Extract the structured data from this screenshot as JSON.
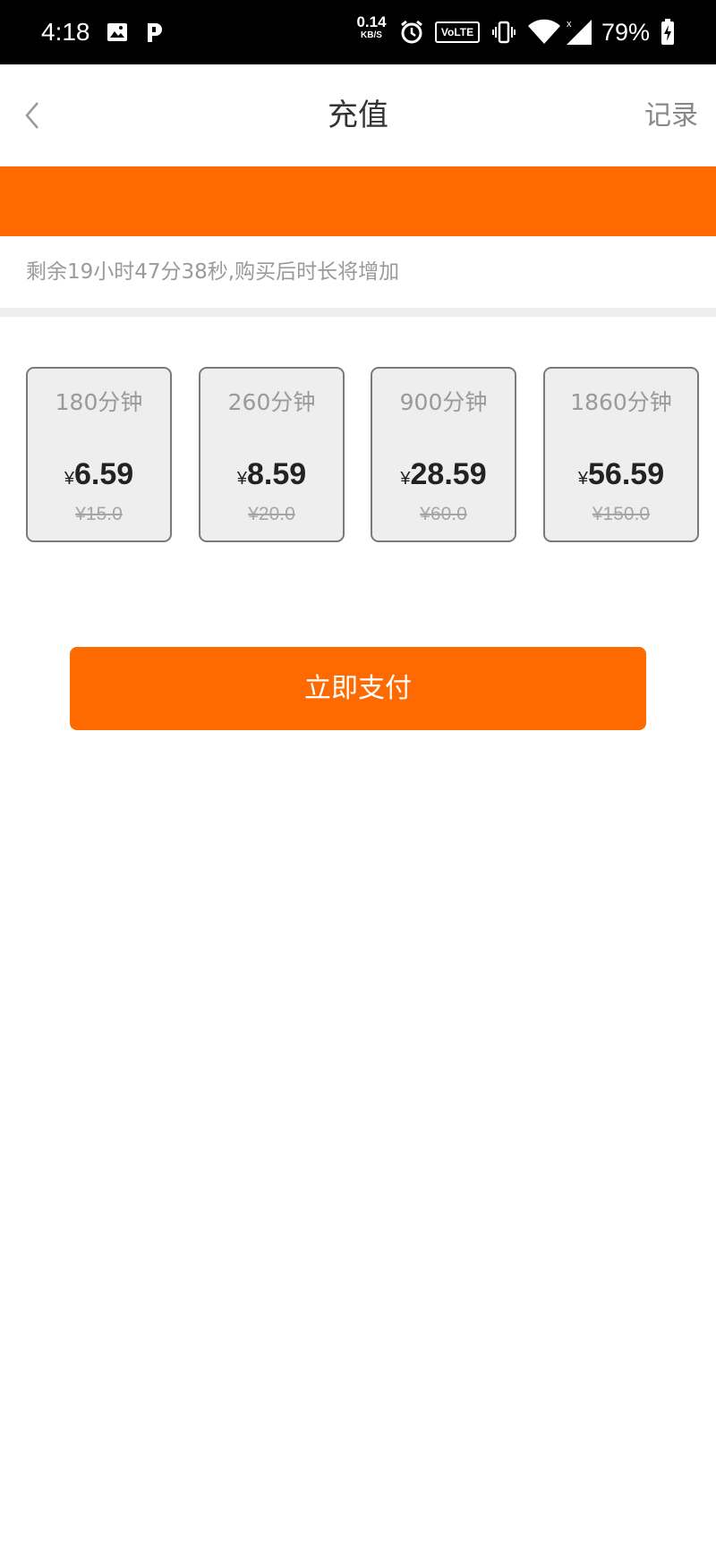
{
  "status_bar": {
    "time": "4:18",
    "net_speed_value": "0.14",
    "net_speed_unit": "KB/S",
    "volte_label": "VoLTE",
    "battery_percent": "79%",
    "icons": [
      "image-icon",
      "p-app-icon",
      "alarm-icon",
      "vibrate-icon",
      "wifi-icon",
      "signal-icon",
      "battery-charging-icon"
    ]
  },
  "nav": {
    "back_icon": "chevron-left-icon",
    "title": "充值",
    "record_label": "记录"
  },
  "banner": {
    "color": "#ff6a00"
  },
  "info": {
    "remaining_text": "剩余19小时47分38秒,购买后时长将增加"
  },
  "packages": [
    {
      "minutes": "180分钟",
      "currency": "¥",
      "price": "6.59",
      "original": "¥15.0"
    },
    {
      "minutes": "260分钟",
      "currency": "¥",
      "price": "8.59",
      "original": "¥20.0"
    },
    {
      "minutes": "900分钟",
      "currency": "¥",
      "price": "28.59",
      "original": "¥60.0"
    },
    {
      "minutes": "1860分钟",
      "currency": "¥",
      "price": "56.59",
      "original": "¥150.0"
    }
  ],
  "pay_button": {
    "label": "立即支付"
  },
  "colors": {
    "accent": "#ff6a00",
    "card_bg": "#eeeeee",
    "card_border": "#7a7a7a"
  }
}
